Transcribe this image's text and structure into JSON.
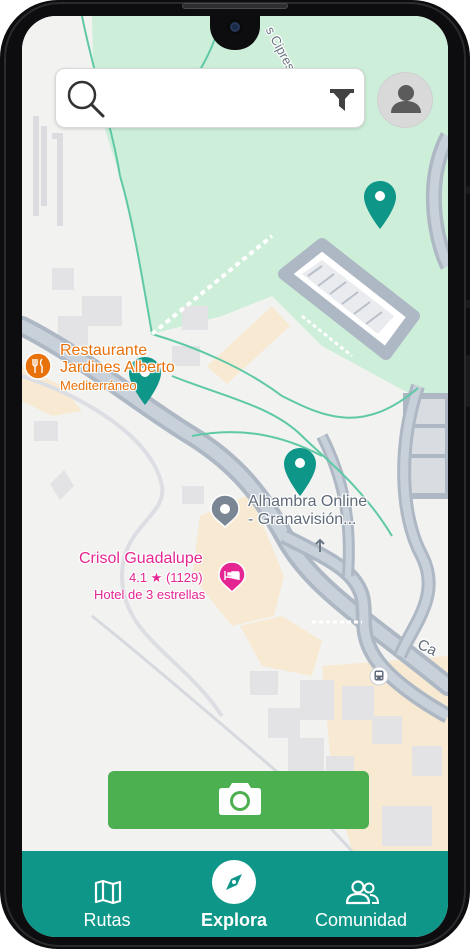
{
  "search": {
    "placeholder": ""
  },
  "map": {
    "places": [
      {
        "name_line1": "Restaurante",
        "name_line2": "Jardines Alberto",
        "category": "Mediterráneo"
      },
      {
        "name_line1": "Alhambra Online",
        "name_line2": "- Granavisión..."
      },
      {
        "name_line1": "Crisol Guadalupe",
        "rating": "4.1 ★ (1129)",
        "category": "Hotel de 3 estrellas"
      }
    ],
    "street_labels": [
      "s Cipres",
      "Ca"
    ]
  },
  "camera_button": {
    "icon": "camera-icon"
  },
  "bottom_nav": {
    "items": [
      {
        "label": "Rutas",
        "icon": "map-icon"
      },
      {
        "label": "Explora",
        "icon": "compass-icon",
        "active": true
      },
      {
        "label": "Comunidad",
        "icon": "community-icon"
      }
    ]
  },
  "colors": {
    "accent": "#0e9688",
    "pin": "#0e9688",
    "camera_button": "#4caf50",
    "park": "#cdeed9",
    "restaurant": "#e8710a",
    "hotel": "#e52592"
  }
}
